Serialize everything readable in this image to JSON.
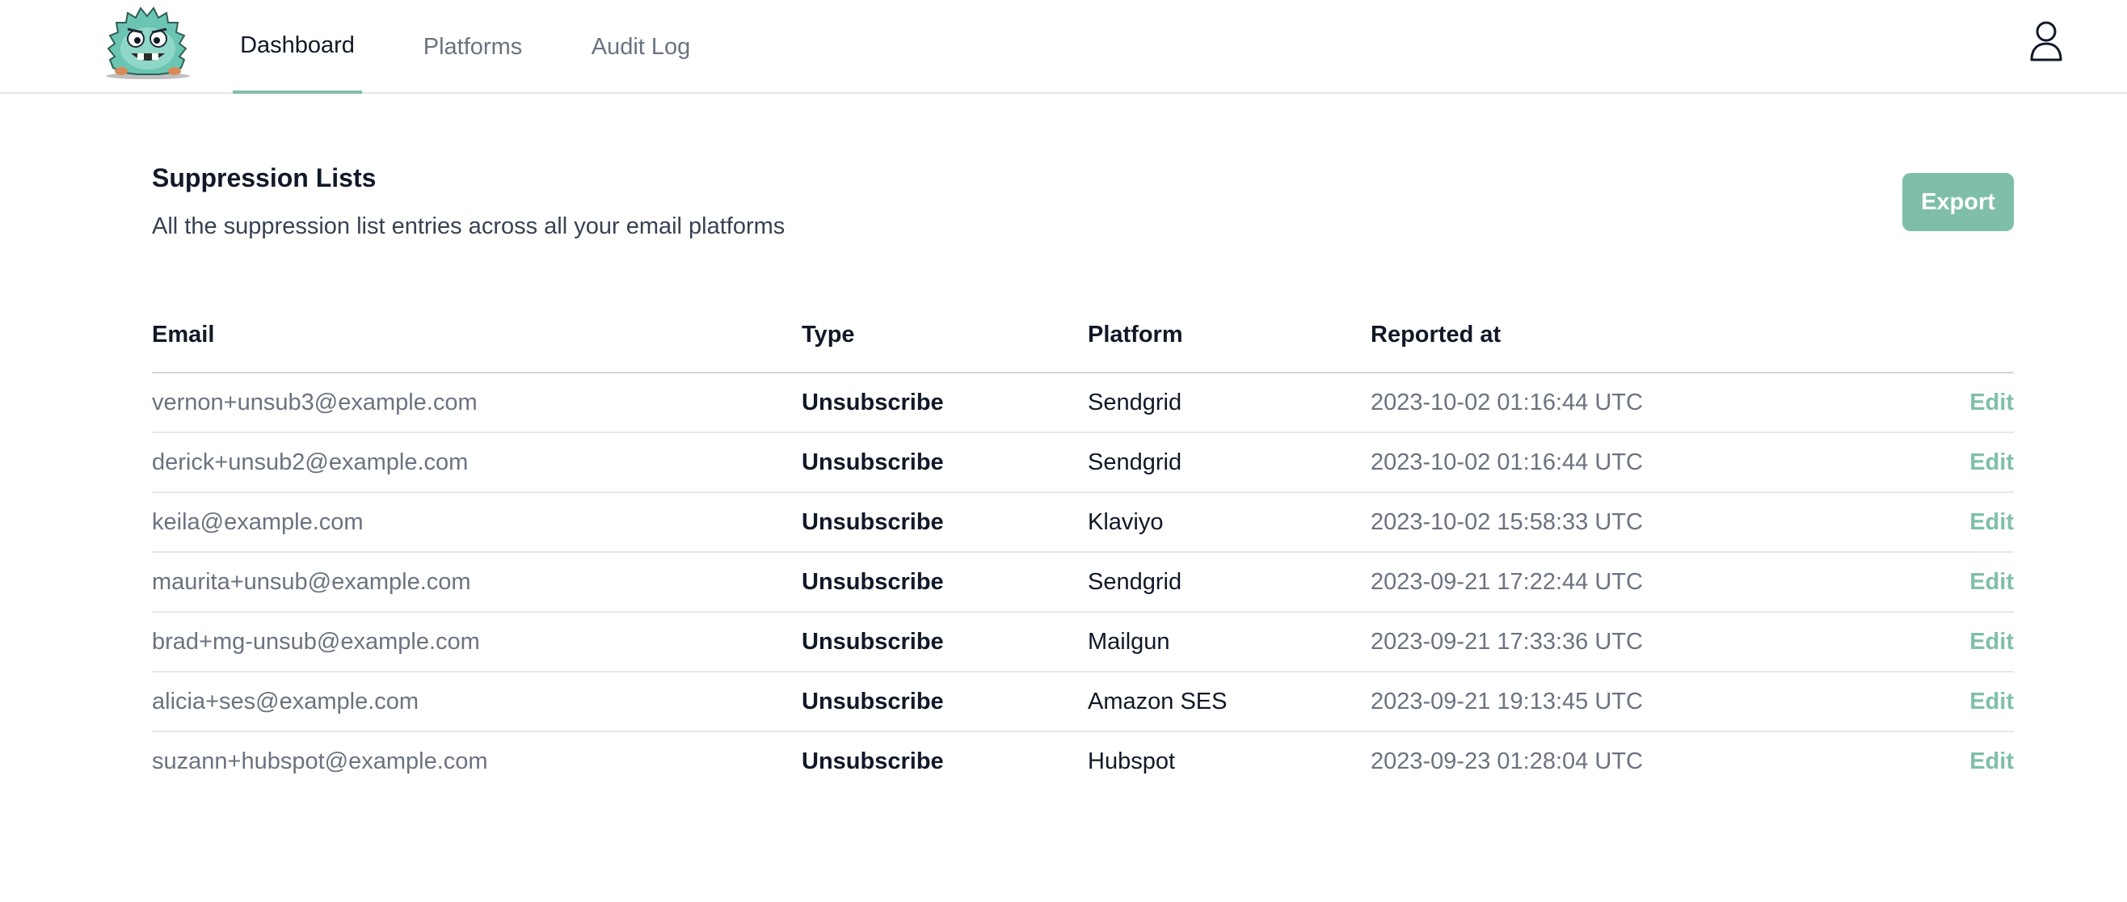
{
  "nav": {
    "logo_alt": "monster mascot logo",
    "tabs": [
      {
        "label": "Dashboard",
        "active": true
      },
      {
        "label": "Platforms",
        "active": false
      },
      {
        "label": "Audit Log",
        "active": false
      }
    ],
    "user_icon": "user-icon"
  },
  "header": {
    "title": "Suppression Lists",
    "subtitle": "All the suppression list entries across all your email platforms",
    "export_label": "Export"
  },
  "table": {
    "columns": [
      "Email",
      "Type",
      "Platform",
      "Reported at",
      ""
    ],
    "edit_label": "Edit",
    "rows": [
      {
        "email": "vernon+unsub3@example.com",
        "type": "Unsubscribe",
        "platform": "Sendgrid",
        "reported_at": "2023-10-02 01:16:44 UTC"
      },
      {
        "email": "derick+unsub2@example.com",
        "type": "Unsubscribe",
        "platform": "Sendgrid",
        "reported_at": "2023-10-02 01:16:44 UTC"
      },
      {
        "email": "keila@example.com",
        "type": "Unsubscribe",
        "platform": "Klaviyo",
        "reported_at": "2023-10-02 15:58:33 UTC"
      },
      {
        "email": "maurita+unsub@example.com",
        "type": "Unsubscribe",
        "platform": "Sendgrid",
        "reported_at": "2023-09-21 17:22:44 UTC"
      },
      {
        "email": "brad+mg-unsub@example.com",
        "type": "Unsubscribe",
        "platform": "Mailgun",
        "reported_at": "2023-09-21 17:33:36 UTC"
      },
      {
        "email": "alicia+ses@example.com",
        "type": "Unsubscribe",
        "platform": "Amazon SES",
        "reported_at": "2023-09-21 19:13:45 UTC"
      },
      {
        "email": "suzann+hubspot@example.com",
        "type": "Unsubscribe",
        "platform": "Hubspot",
        "reported_at": "2023-09-23 01:28:04 UTC"
      }
    ]
  },
  "colors": {
    "accent": "#7fbfa8",
    "text_primary": "#111827",
    "text_muted": "#6b7280",
    "border": "#e5e7eb"
  }
}
